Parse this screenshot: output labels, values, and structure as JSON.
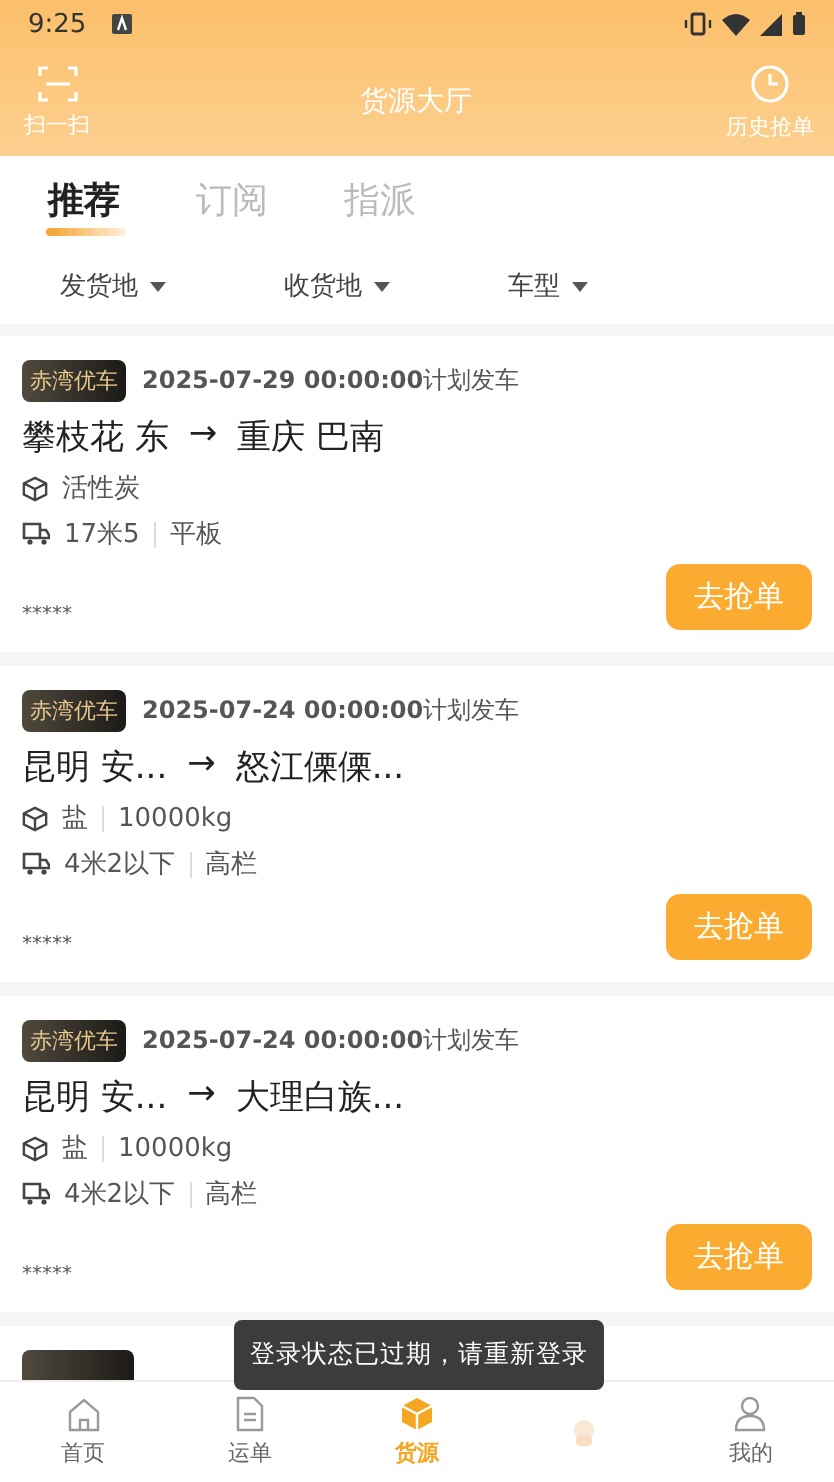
{
  "status_bar": {
    "time": "9:25"
  },
  "header": {
    "left_label": "扫一扫",
    "title": "货源大厅",
    "right_label": "历史抢单"
  },
  "tabs": [
    {
      "label": "推荐",
      "selected": true
    },
    {
      "label": "订阅",
      "selected": false
    },
    {
      "label": "指派",
      "selected": false
    }
  ],
  "filters": [
    "发货地",
    "收货地",
    "车型"
  ],
  "cards": [
    {
      "badge": "赤湾优车",
      "date": "2025-07-29 00:00:00",
      "date_suffix": "计划发车",
      "from": "攀枝花 东",
      "arrow": "→",
      "to": "重庆 巴南",
      "goods": [
        "活性炭"
      ],
      "truck": [
        "17米5",
        "平板"
      ],
      "stars": "*****",
      "button": "去抢单"
    },
    {
      "badge": "赤湾优车",
      "date": "2025-07-24 00:00:00",
      "date_suffix": "计划发车",
      "from": "昆明 安...",
      "arrow": "→",
      "to": "怒江傈傈...",
      "goods": [
        "盐",
        "10000kg"
      ],
      "truck": [
        "4米2以下",
        "高栏"
      ],
      "stars": "*****",
      "button": "去抢单"
    },
    {
      "badge": "赤湾优车",
      "date": "2025-07-24 00:00:00",
      "date_suffix": "计划发车",
      "from": "昆明 安...",
      "arrow": "→",
      "to": "大理白族...",
      "goods": [
        "盐",
        "10000kg"
      ],
      "truck": [
        "4米2以下",
        "高栏"
      ],
      "stars": "*****",
      "button": "去抢单"
    }
  ],
  "toast": "登录状态已过期，请重新登录",
  "nav": [
    {
      "kind": "home",
      "label": "首页",
      "selected": false
    },
    {
      "kind": "doc",
      "label": "运单",
      "selected": false
    },
    {
      "kind": "box",
      "label": "货源",
      "selected": true
    },
    {
      "kind": "mascot",
      "selected": false
    },
    {
      "kind": "user",
      "label": "我的",
      "selected": false
    }
  ]
}
